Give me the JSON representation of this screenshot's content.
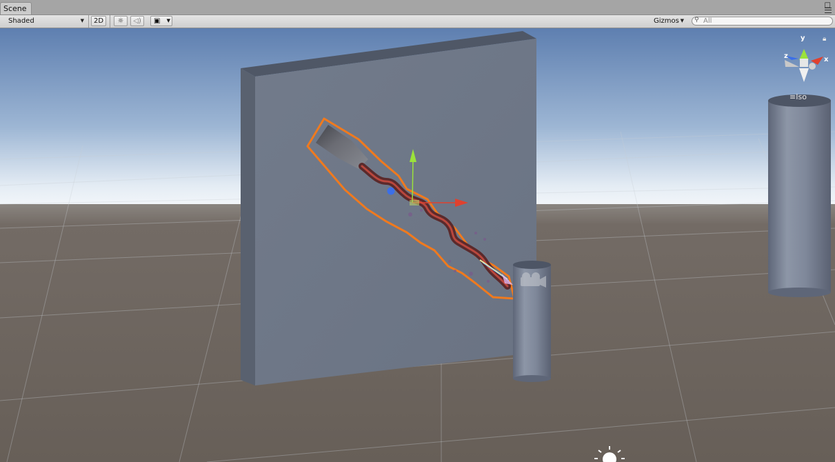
{
  "tab": {
    "title": "Scene"
  },
  "toolbar": {
    "shading_mode": "Shaded",
    "mode_2d": "2D",
    "gizmos": "Gizmos",
    "search_placeholder": "All"
  },
  "gizmo": {
    "axis_y": "y",
    "axis_x": "x",
    "axis_z": "z",
    "projection": "Iso"
  },
  "icons": [
    "light-toggle-icon",
    "audio-toggle-icon",
    "effects-image-icon",
    "search-icon",
    "lock-icon",
    "directional-light-icon",
    "camera-gizmo-icon"
  ],
  "colors": {
    "sky_top": "#6585b4",
    "sky_horizon": "#e9f0f7",
    "ground": "#6d6560",
    "wall": "#6f7888",
    "selection_outline": "#f07a1e",
    "axis_x": "#e0412e",
    "axis_y": "#9be23a",
    "axis_z": "#3b6fe8"
  }
}
